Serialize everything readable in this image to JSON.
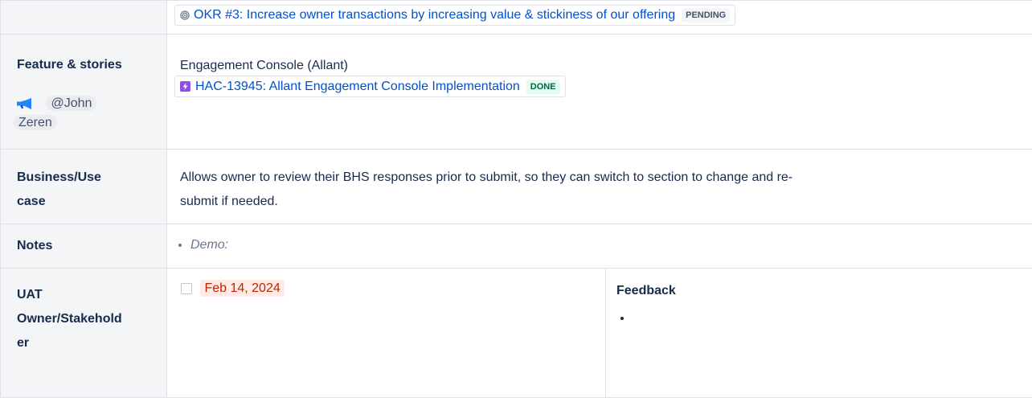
{
  "okr_link": {
    "text": "OKR #3: Increase owner transactions by increasing value & stickiness of our offering",
    "status": "PENDING",
    "icon": "target-icon"
  },
  "feature": {
    "header": "Feature & stories",
    "owner_mention_line1": "@John",
    "owner_mention_line2": "Zeren",
    "owner_icon": "megaphone-icon",
    "title": "Engagement Console (Allant)",
    "issue_link": "HAC-13945: Allant Engagement Console Implementation",
    "issue_status": "DONE",
    "issue_icon": "epic-icon"
  },
  "business": {
    "header_line1": "Business/Use",
    "header_line2": "case",
    "text_line1": "Allows owner to review their BHS responses prior to submit, so they can switch to section to change and re-",
    "text_line2": "submit if needed."
  },
  "notes": {
    "header": "Notes",
    "item": "Demo:"
  },
  "uat": {
    "header_line1": "UAT",
    "header_line2": "Owner/Stakehold",
    "header_line3": "er",
    "date": "Feb 14, 2024",
    "feedback_label": "Feedback",
    "feedback_item": ""
  },
  "colors": {
    "link": "#0052cc",
    "done_bg": "#e3fcef",
    "done_text": "#006644",
    "date_bg": "#ffebe6",
    "date_text": "#bf2600",
    "header_bg": "#f4f5f7"
  }
}
